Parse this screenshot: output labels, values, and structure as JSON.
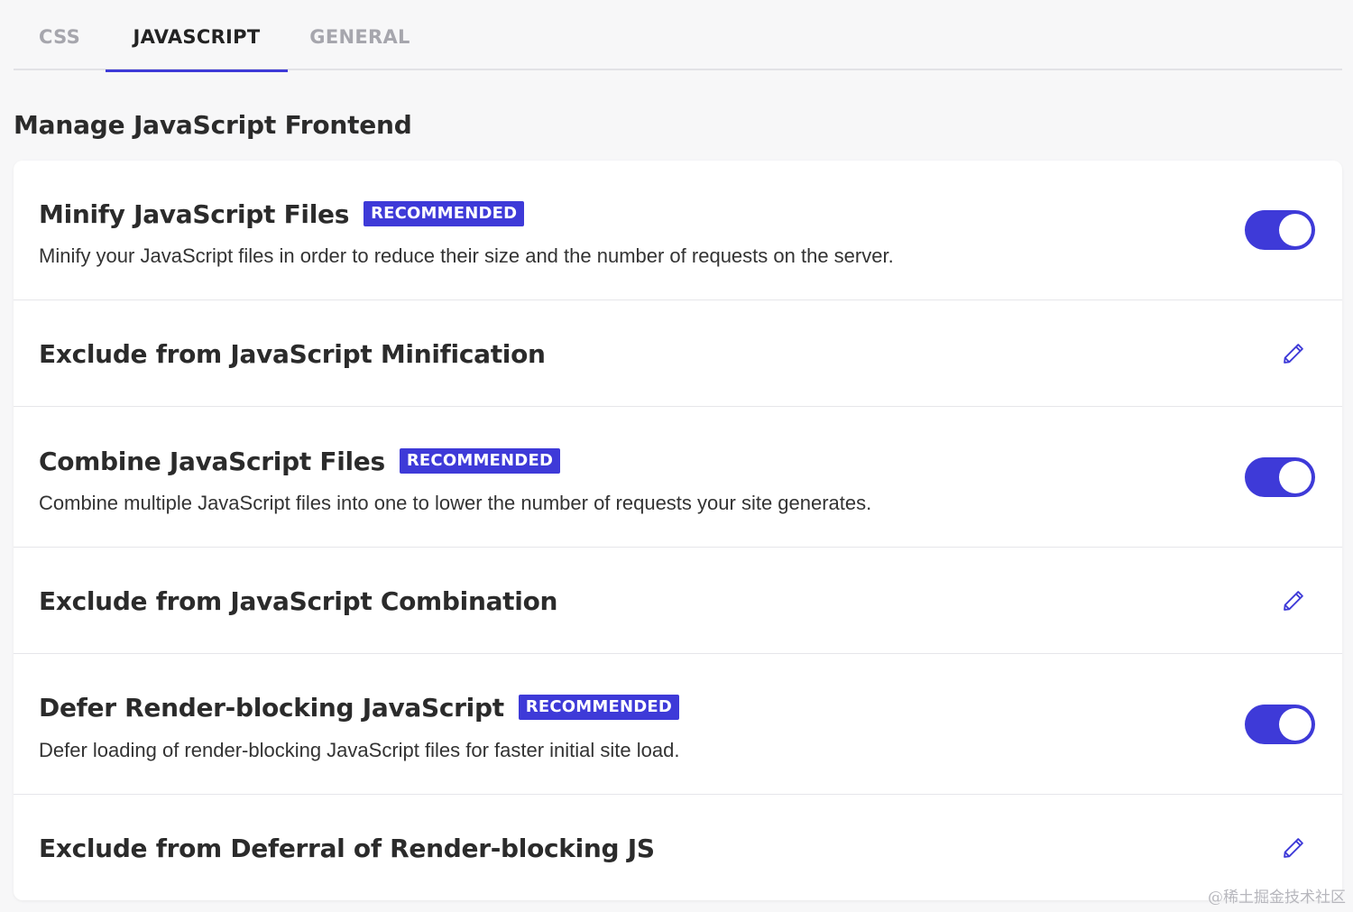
{
  "tabs": [
    {
      "label": "CSS",
      "active": false
    },
    {
      "label": "JAVASCRIPT",
      "active": true
    },
    {
      "label": "GENERAL",
      "active": false
    }
  ],
  "page_title": "Manage JavaScript Frontend",
  "settings": [
    {
      "title": "Minify JavaScript Files",
      "badge": "RECOMMENDED",
      "description": "Minify your JavaScript files in order to reduce their size and the number of requests on the server.",
      "control": "toggle",
      "enabled": true
    },
    {
      "title": "Exclude from JavaScript Minification",
      "control": "edit",
      "icon": "pencil-icon"
    },
    {
      "title": "Combine JavaScript Files",
      "badge": "RECOMMENDED",
      "description": "Combine multiple JavaScript files into one to lower the number of requests your site generates.",
      "control": "toggle",
      "enabled": true
    },
    {
      "title": "Exclude from JavaScript Combination",
      "control": "edit",
      "icon": "pencil-icon"
    },
    {
      "title": "Defer Render-blocking JavaScript",
      "badge": "RECOMMENDED",
      "description": "Defer loading of render-blocking JavaScript files for faster initial site load.",
      "control": "toggle",
      "enabled": true
    },
    {
      "title": "Exclude from Deferral of Render-blocking JS",
      "control": "edit",
      "icon": "pencil-icon"
    }
  ],
  "watermark": "@稀土掘金技术社区",
  "colors": {
    "accent": "#3e3ad8",
    "background": "#f7f7f8",
    "card": "#ffffff",
    "text": "#2b2b2b",
    "muted_tab": "#a6a6ad"
  }
}
